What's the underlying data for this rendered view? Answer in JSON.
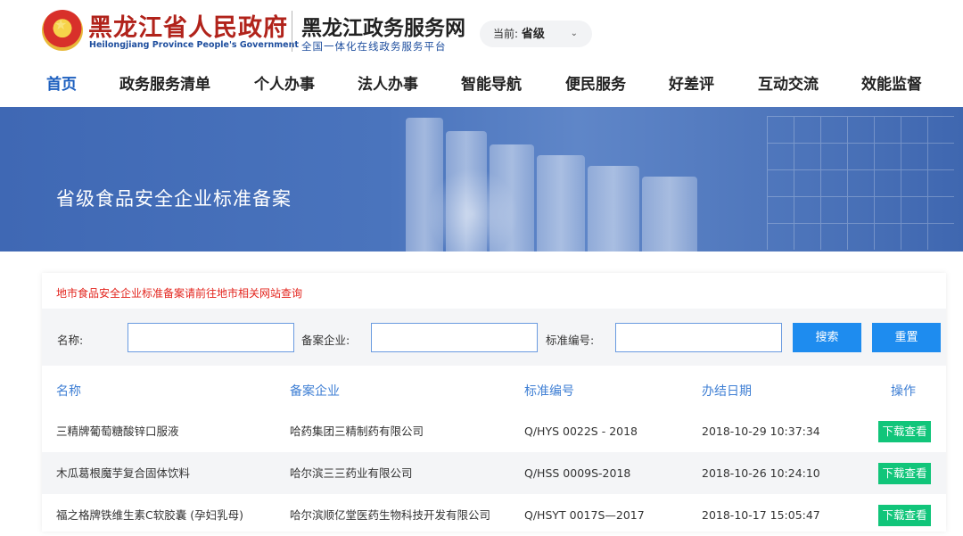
{
  "header": {
    "gov_name": "黑龙江省人民政府",
    "gov_name_en": "Heilongjiang Province People's Government",
    "site_name": "黑龙江政务服务网",
    "site_subtitle": "全国一体化在线政务服务平台",
    "level_prefix": "当前:",
    "level_value": "省级",
    "level_chevron": "⌄"
  },
  "nav": {
    "items": [
      {
        "label": "首页",
        "active": true
      },
      {
        "label": "政务服务清单"
      },
      {
        "label": "个人办事"
      },
      {
        "label": "法人办事"
      },
      {
        "label": "智能导航"
      },
      {
        "label": "便民服务"
      },
      {
        "label": "好差评"
      },
      {
        "label": "互动交流"
      },
      {
        "label": "效能监督"
      }
    ]
  },
  "banner": {
    "title": "省级食品安全企业标准备案"
  },
  "notice": "地市食品安全企业标准备案请前往地市相关网站查询",
  "search": {
    "name_label": "名称:",
    "company_label": "备案企业:",
    "standard_label": "标准编号:",
    "name_value": "",
    "company_value": "",
    "standard_value": "",
    "search_button": "搜索",
    "reset_button": "重置"
  },
  "table": {
    "headers": [
      "名称",
      "备案企业",
      "标准编号",
      "办结日期",
      "操作"
    ],
    "rows": [
      {
        "name": "三精牌葡萄糖酸锌口服液",
        "company": "哈药集团三精制药有限公司",
        "standard": "Q/HYS 0022S - 2018",
        "date": "2018-10-29 10:37:34",
        "action": "下载查看"
      },
      {
        "name": "木瓜葛根魔芋复合固体饮料",
        "company": "哈尔滨三三药业有限公司",
        "standard": "Q/HSS 0009S-2018",
        "date": "2018-10-26 10:24:10",
        "action": "下载查看"
      },
      {
        "name": "福之格牌铁维生素C软胶囊 (孕妇乳母)",
        "company": "哈尔滨顺亿堂医药生物科技开发有限公司",
        "standard": "Q/HSYT 0017S—2017",
        "date": "2018-10-17 15:05:47",
        "action": "下载查看"
      }
    ]
  },
  "colors": {
    "brand_red": "#b1231b",
    "nav_active": "#1c5fbf",
    "button_blue": "#1e8cef",
    "download_green": "#11c57a",
    "notice_red": "#e3241d"
  }
}
